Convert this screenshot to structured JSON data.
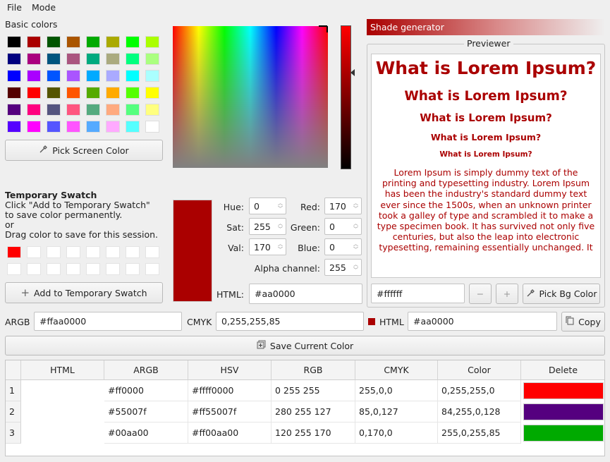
{
  "menu": {
    "file": "File",
    "mode": "Mode"
  },
  "basic_colors": {
    "label": "Basic colors",
    "rows": [
      [
        "#000000",
        "#aa0000",
        "#005500",
        "#aa5500",
        "#00aa00",
        "#aaaa00",
        "#00ff00",
        "#aaff00"
      ],
      [
        "#00007f",
        "#aa007f",
        "#00557f",
        "#aa557f",
        "#00aa7f",
        "#aaaa7f",
        "#00ff7f",
        "#aaff7f"
      ],
      [
        "#0000ff",
        "#aa00ff",
        "#0055ff",
        "#aa55ff",
        "#00aaff",
        "#aaaaff",
        "#00ffff",
        "#aaffff"
      ],
      [
        "#550000",
        "#ff0000",
        "#555500",
        "#ff5500",
        "#55aa00",
        "#ffaa00",
        "#55ff00",
        "#ffff00"
      ],
      [
        "#55007f",
        "#ff007f",
        "#55557f",
        "#ff557f",
        "#55aa7f",
        "#ffaa7f",
        "#55ff7f",
        "#ffff7f"
      ],
      [
        "#5500ff",
        "#ff00ff",
        "#5555ff",
        "#ff55ff",
        "#55aaff",
        "#ffaaff",
        "#55ffff",
        "#ffffff"
      ]
    ]
  },
  "pick_screen_color": "Pick Screen Color",
  "temp_swatch": {
    "title": "Temporary Swatch",
    "line1": "Click \"Add to Temporary Swatch\"",
    "line2": "to save color permanently.",
    "line3": "or",
    "line4": "Drag color to save for this session.",
    "first_color": "#ff0000",
    "add_button": "Add to Temporary Swatch"
  },
  "current_color": "#aa0000",
  "fields": {
    "hue_label": "Hue:",
    "hue": "0",
    "sat_label": "Sat:",
    "sat": "255",
    "val_label": "Val:",
    "val": "170",
    "red_label": "Red:",
    "red": "170",
    "green_label": "Green:",
    "green": "0",
    "blue_label": "Blue:",
    "blue": "0",
    "alpha_label": "Alpha channel:",
    "alpha": "255",
    "html_label": "HTML:",
    "html": "#aa0000"
  },
  "shade_generator": "Shade generator",
  "previewer": {
    "title": "Previewer",
    "heading": "What is Lorem Ipsum?",
    "body": "Lorem Ipsum is simply dummy text of the printing and typesetting industry. Lorem Ipsum has been the industry's standard dummy text ever since the 1500s, when an unknown printer took a galley of type and scrambled it to make a type specimen book. It has survived not only five centuries, but also the leap into electronic typesetting, remaining essentially unchanged. It",
    "bg_value": "#ffffff",
    "minus": "−",
    "plus": "+",
    "pick_bg": "Pick Bg Color"
  },
  "formats": {
    "argb_label": "ARGB",
    "argb": "#ffaa0000",
    "cmyk_label": "CMYK",
    "cmyk": "0,255,255,85",
    "html_label": "HTML",
    "html": "#aa0000",
    "copy": "Copy"
  },
  "save_current": "Save Current Color",
  "table": {
    "headers": [
      "HTML",
      "ARGB",
      "HSV",
      "RGB",
      "CMYK",
      "Color",
      "Delete"
    ],
    "rows": [
      {
        "num": "1",
        "html": "#ff0000",
        "argb": "#ffff0000",
        "hsv": "0 255 255",
        "rgb": "255,0,0",
        "cmyk": "0,255,255,0",
        "color": "#ff0000",
        "del": "Delete"
      },
      {
        "num": "2",
        "html": "#55007f",
        "argb": "#ff55007f",
        "hsv": "280 255 127",
        "rgb": "85,0,127",
        "cmyk": "84,255,0,128",
        "color": "#55007f",
        "del": "Delete"
      },
      {
        "num": "3",
        "html": "#00aa00",
        "argb": "#ff00aa00",
        "hsv": "120 255 170",
        "rgb": "0,170,0",
        "cmyk": "255,0,255,85",
        "color": "#00aa00",
        "del": "Delete"
      }
    ]
  }
}
